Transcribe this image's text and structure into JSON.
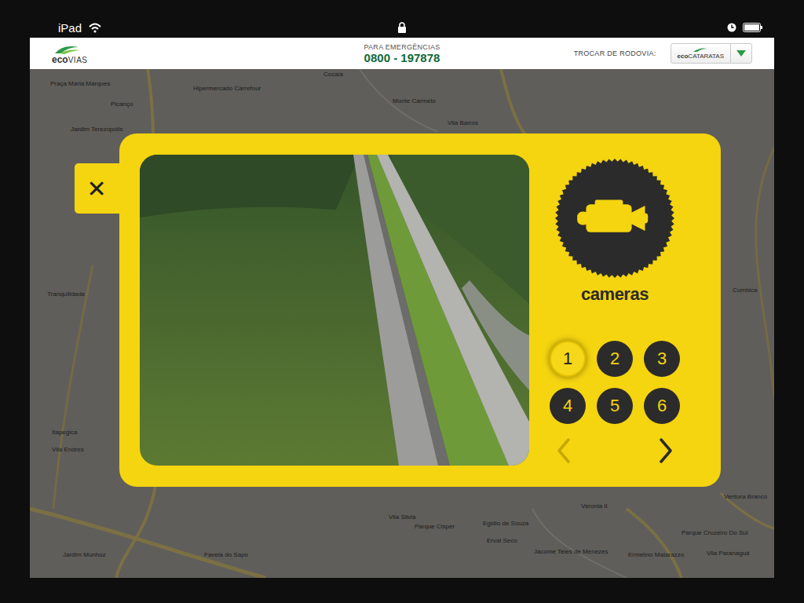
{
  "status_bar": {
    "device": "iPad"
  },
  "header": {
    "logo": {
      "prefix": "eco",
      "suffix": "VIAS"
    },
    "emergency_label": "PARA EMERGÊNCIAS",
    "emergency_phone": "0800 - 197878",
    "switch_label": "TROCAR DE RODOVIA:",
    "switch_value": {
      "prefix": "eco",
      "suffix": "CATARATAS"
    }
  },
  "map": {
    "labels": [
      "Praça Maria Marques",
      "Picanço",
      "Jardim Terezopolis",
      "Hipermercado Carrefour",
      "Cocaia",
      "Monte Carmelo",
      "Vila Barros",
      "Tranquilidade",
      "Itapegica",
      "Vila Endres",
      "Jardim Munhoz",
      "Favela do Sapo",
      "Vila Silvia",
      "Parque Cisper",
      "Egidio de Souza",
      "Erval Seco",
      "Jacome Teles de Menezes",
      "Veronia II",
      "Ermelino Matarazzo",
      "Cumbica",
      "Ventura Branco",
      "Parque Cruzeiro Do Sul",
      "Vila Paranaguá"
    ]
  },
  "modal": {
    "close": "✕",
    "title": "cameras",
    "cameras": [
      {
        "label": "1",
        "selected": true
      },
      {
        "label": "2",
        "selected": false
      },
      {
        "label": "3",
        "selected": false
      },
      {
        "label": "4",
        "selected": false
      },
      {
        "label": "5",
        "selected": false
      },
      {
        "label": "6",
        "selected": false
      }
    ],
    "prev_disabled": true,
    "next_disabled": false
  }
}
